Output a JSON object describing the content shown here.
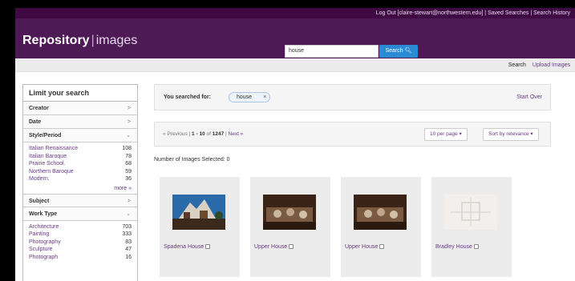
{
  "top_links": {
    "logout": "Log Out [claire-stewart@northwestern.edu]",
    "saved_searches": "Saved Searches",
    "search_history": "Search History"
  },
  "brand": {
    "name": "Repository",
    "separator": "|",
    "sub": "images"
  },
  "search": {
    "value": "house",
    "button_label": "Search"
  },
  "subnav": {
    "search": "Search",
    "upload": "Upload Images"
  },
  "sidebar": {
    "title": "Limit your search",
    "creator": "Creator",
    "date": "Date",
    "style_period": {
      "label": "Style/Period",
      "items": [
        {
          "label": "Italian Renaissance",
          "count": "108"
        },
        {
          "label": "Italian Baroque",
          "count": "78"
        },
        {
          "label": "Prairie School.",
          "count": "68"
        },
        {
          "label": "Northern Baroque",
          "count": "59"
        },
        {
          "label": "Modern.",
          "count": "36"
        }
      ],
      "more": "more »"
    },
    "subject": "Subject",
    "work_type": {
      "label": "Work Type",
      "items": [
        {
          "label": "Architecture",
          "count": "703"
        },
        {
          "label": "Painting",
          "count": "333"
        },
        {
          "label": "Photography",
          "count": "83"
        },
        {
          "label": "Sculpture",
          "count": "47"
        },
        {
          "label": "Photograph",
          "count": "16"
        }
      ]
    }
  },
  "searched_for": {
    "label": "You searched for:",
    "term": "house",
    "remove": "×",
    "start_over": "Start Over"
  },
  "pager": {
    "prev": "« Previous",
    "sep": "|",
    "range": "1 - 10",
    "of": "of",
    "total": "1247",
    "next": "Next »",
    "per_page": "10 per page ▾",
    "sort": "Sort by relevance ▾"
  },
  "num_selected": "Number of Images Selected: 0",
  "results": [
    {
      "caption": "Spadena House"
    },
    {
      "caption": "Upper House"
    },
    {
      "caption": "Upper House"
    },
    {
      "caption": "Bradley House"
    }
  ],
  "colors": {
    "purple_dark": "#3f0a44",
    "purple": "#4e1a55",
    "link": "#6b3a86",
    "button_blue": "#2a8ad4"
  }
}
